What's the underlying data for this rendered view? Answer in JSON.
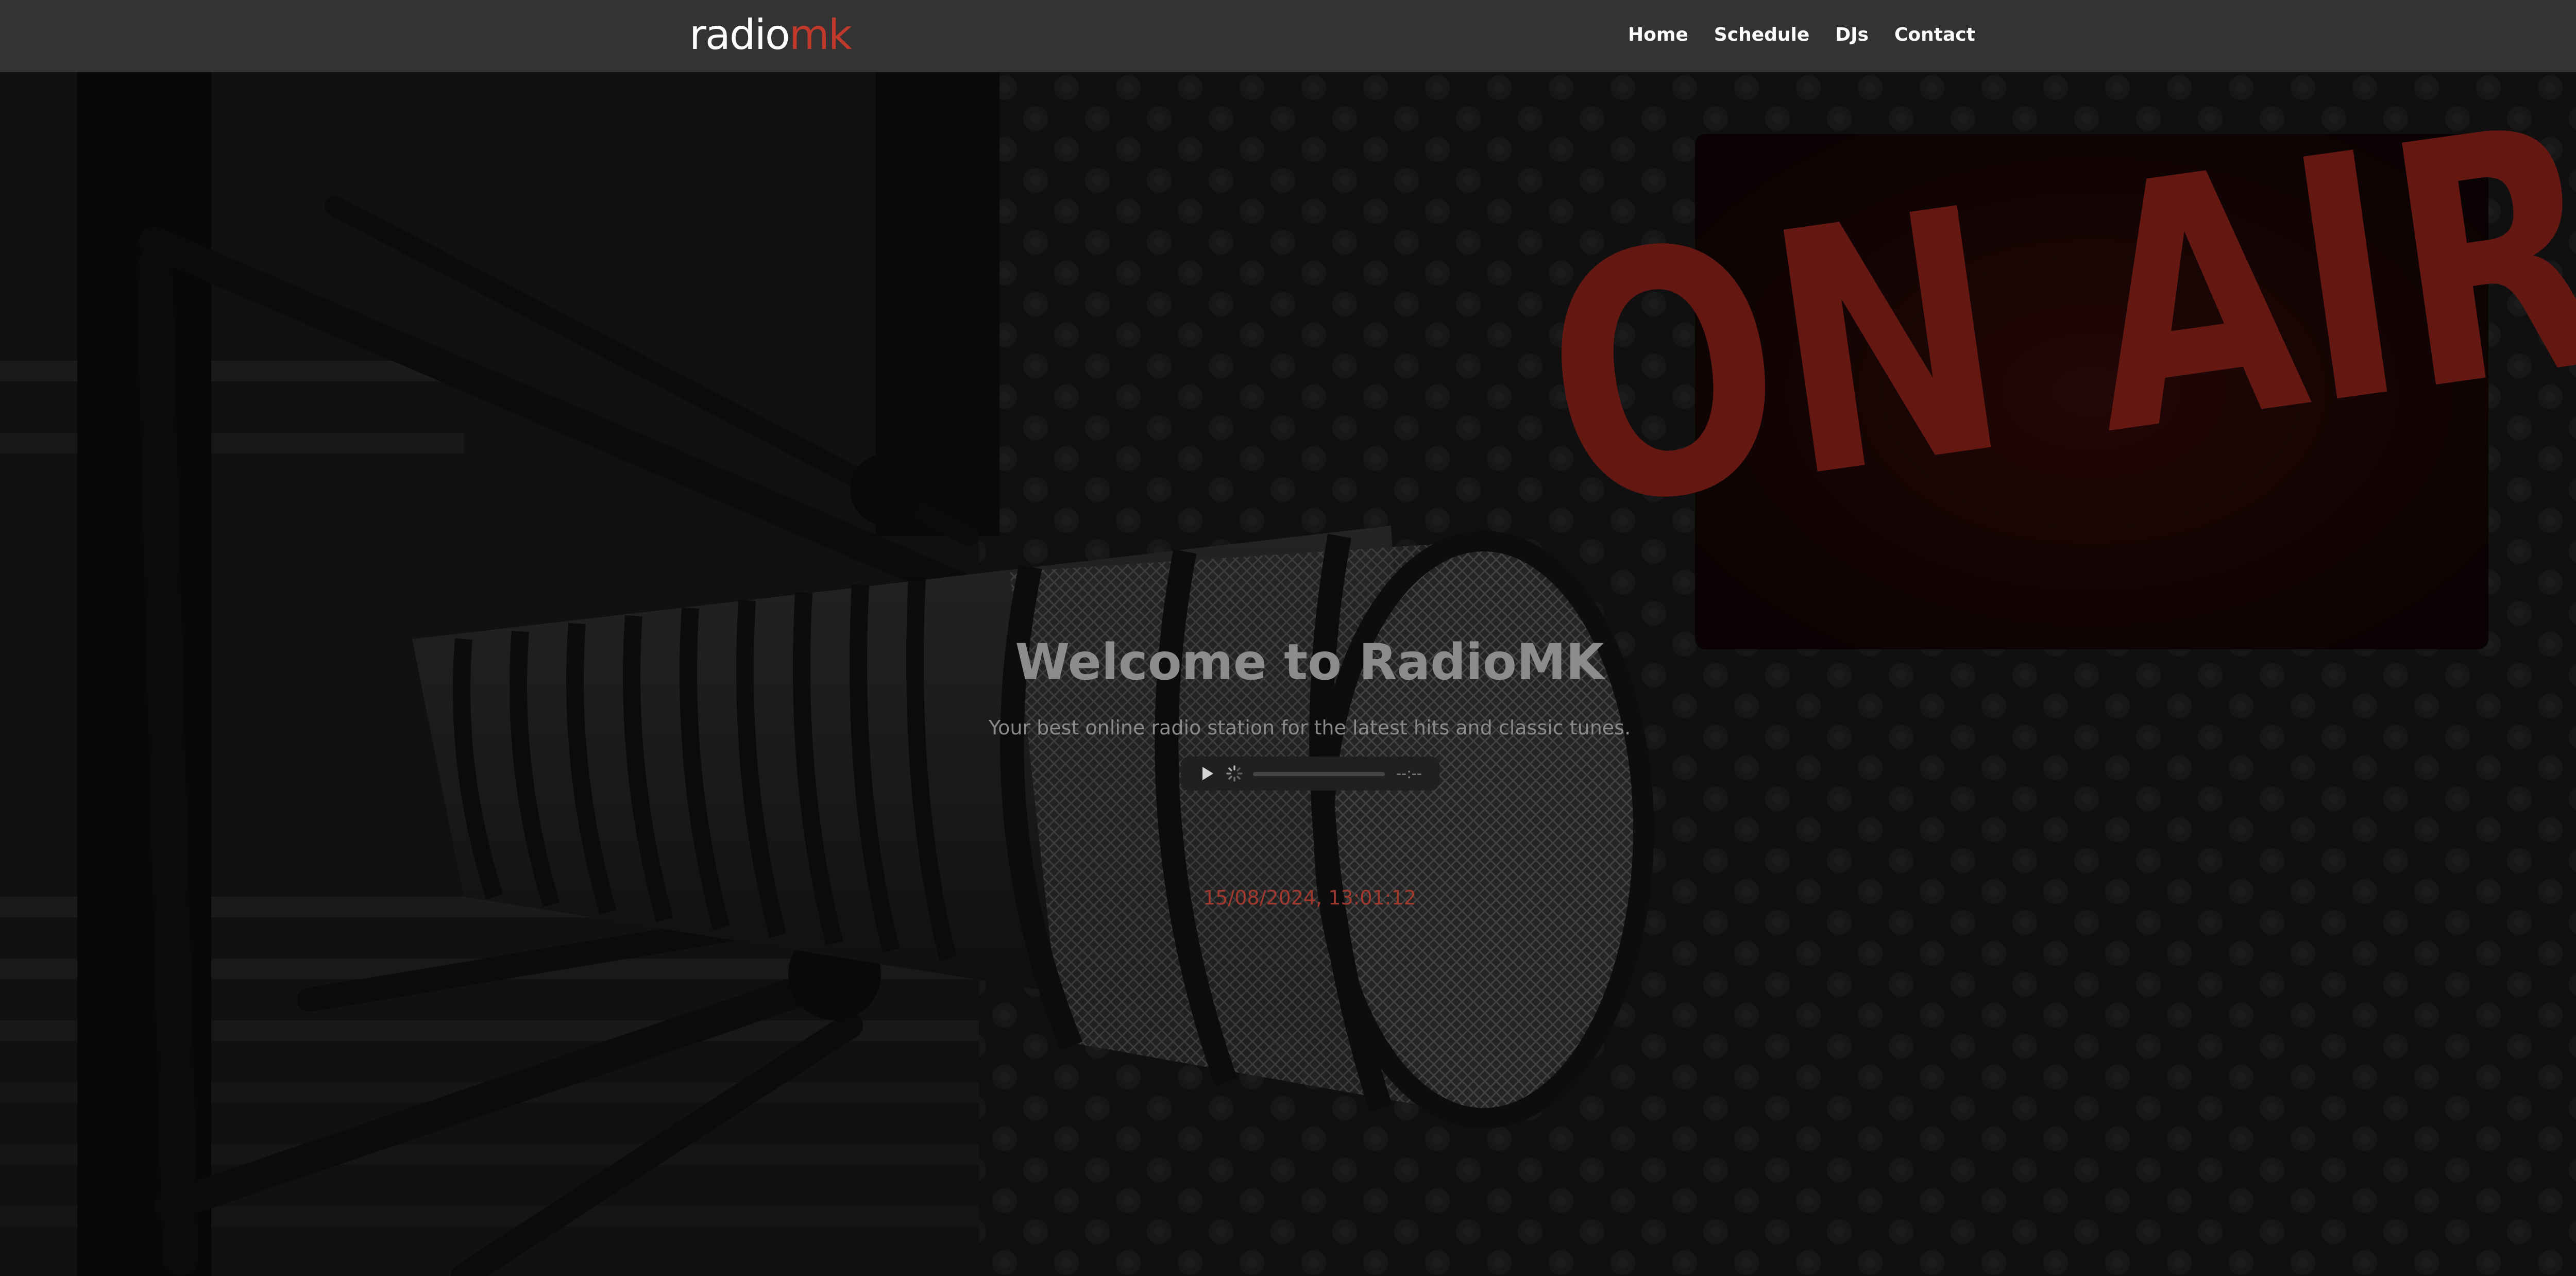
{
  "header": {
    "logo_part1": "radio",
    "logo_part2": "mk",
    "nav": [
      "Home",
      "Schedule",
      "DJs",
      "Contact"
    ]
  },
  "hero": {
    "background_sign": "ON AIR",
    "title": "Welcome to RadioMK",
    "subtitle": "Your best online radio station for the latest hits and classic tunes.",
    "player": {
      "play_icon": "play-icon",
      "status_icon": "loading-icon",
      "time": "--:--"
    },
    "datetime": "15/08/2024, 13:01:12"
  },
  "colors": {
    "header_bg": "#333333",
    "accent": "#c0392b",
    "nav_text": "#ffffff",
    "title_text": "#8c8c8c",
    "datetime_text": "#a3382d"
  }
}
